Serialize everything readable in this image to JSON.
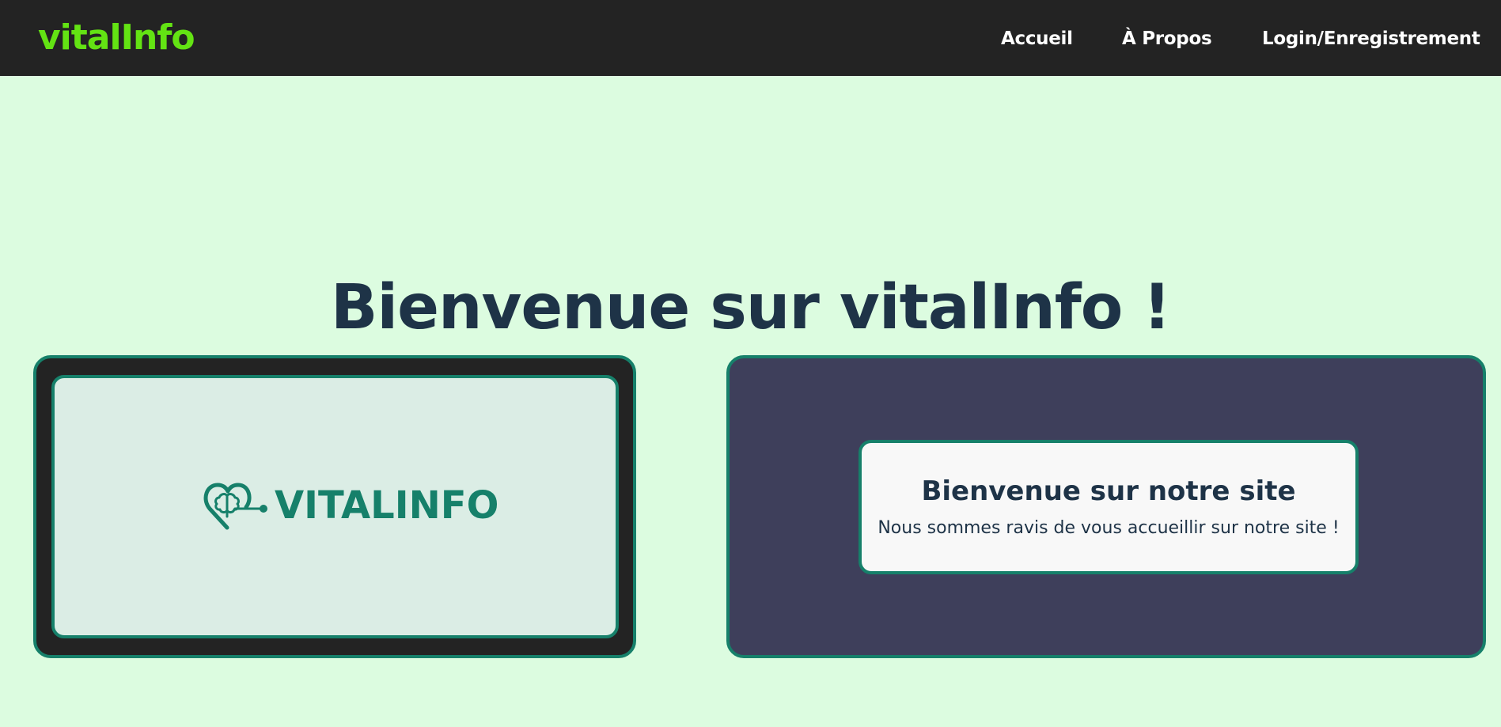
{
  "navbar": {
    "brand": "vitalInfo",
    "links": [
      {
        "label": "Accueil"
      },
      {
        "label": "À Propos"
      },
      {
        "label": "Login/Enregistrement"
      }
    ]
  },
  "hero": {
    "title": "Bienvenue sur vitalInfo !"
  },
  "logo_panel": {
    "logo_text": "VITALINFO",
    "icon": "heart-brain-icon"
  },
  "welcome_card": {
    "title": "Bienvenue sur notre site",
    "text": "Nous sommes ravis de vous accueillir sur notre site !"
  },
  "colors": {
    "page_background": "#dcfce0",
    "navbar": "#232323",
    "brand": "#63e313",
    "accent": "#16806a",
    "title_text": "#1e3347",
    "right_panel": "#3e3f5b"
  }
}
